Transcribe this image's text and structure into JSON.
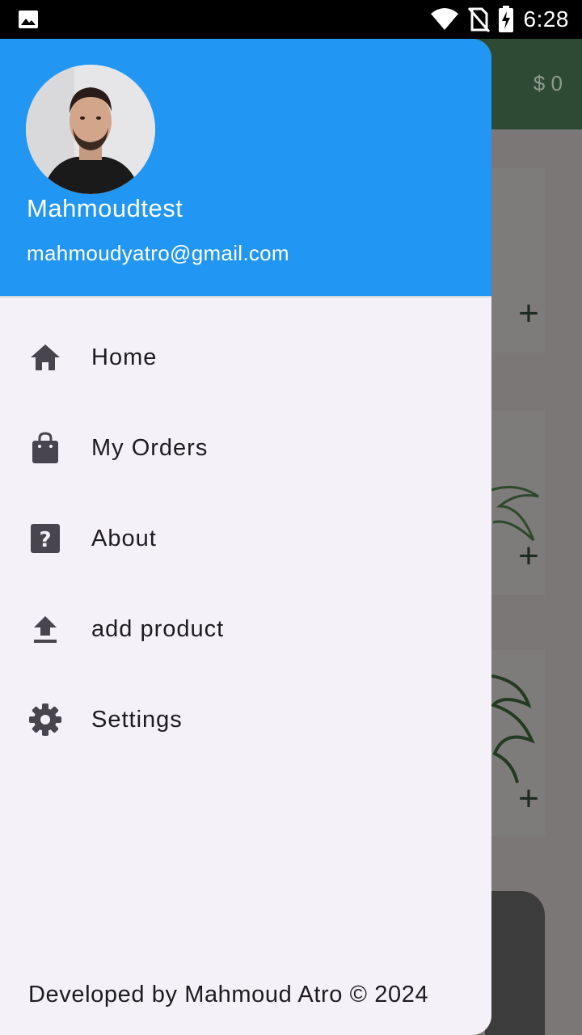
{
  "status_bar": {
    "time": "6:28",
    "icons": [
      "gallery-icon",
      "wifi-icon",
      "no-sim-icon",
      "battery-charging-icon"
    ]
  },
  "background_app": {
    "cart_total": "$ 0",
    "add_icon": "plus-icon"
  },
  "drawer": {
    "header": {
      "user_name": "Mahmoudtest",
      "user_email": "mahmoudyatro@gmail.com",
      "header_color": "#2196f3"
    },
    "items": [
      {
        "label": "Home",
        "icon": "home-icon"
      },
      {
        "label": "My Orders",
        "icon": "shopping-bag-icon"
      },
      {
        "label": "About",
        "icon": "help-icon"
      },
      {
        "label": "add product",
        "icon": "upload-icon"
      },
      {
        "label": "Settings",
        "icon": "settings-icon"
      }
    ],
    "footer": "Developed by Mahmoud Atro © 2024"
  }
}
